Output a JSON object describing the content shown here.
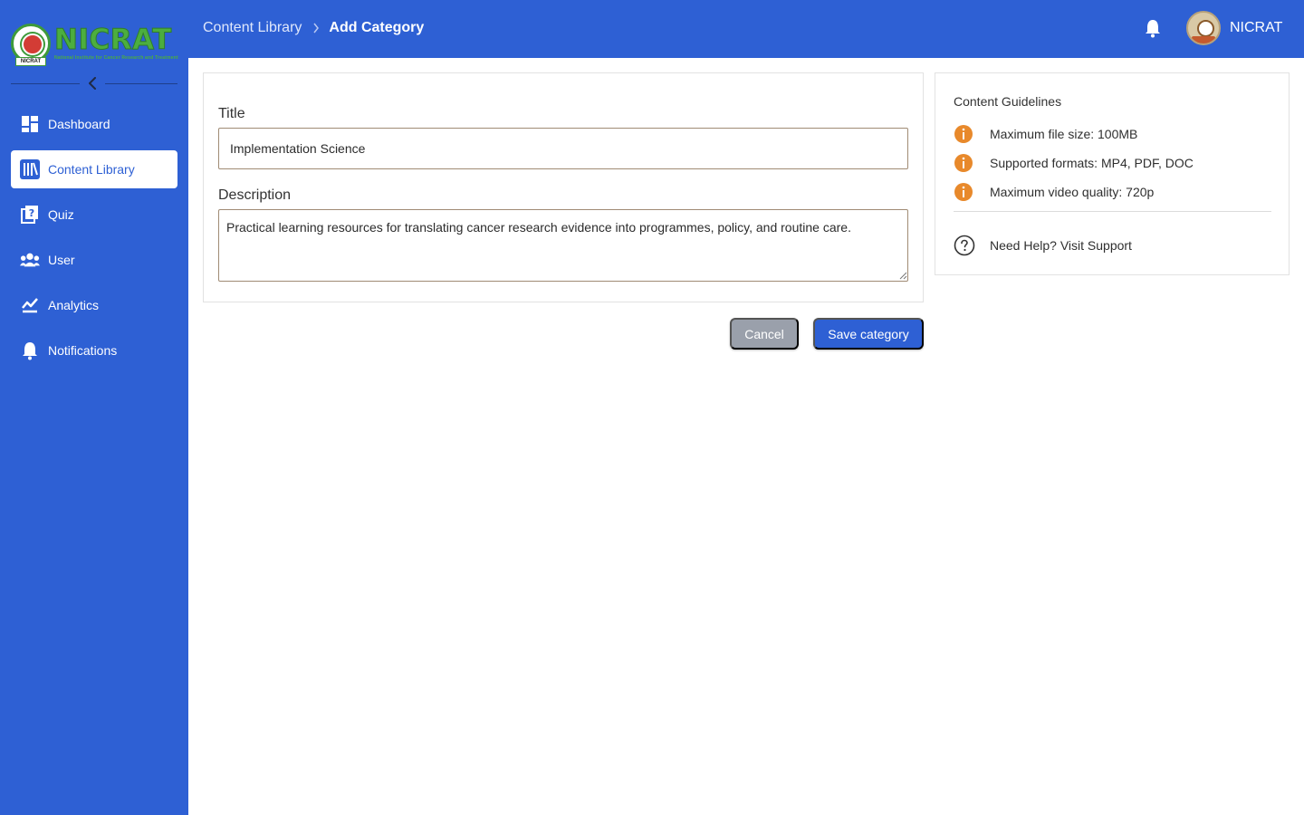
{
  "brand": {
    "name": "NICRAT",
    "tagline": "National Institute for Cancer Research and Treatment",
    "seal_text": "NICRAT",
    "colors": {
      "primary": "#2e60d4",
      "logo_green": "#4cae3f",
      "warning_orange": "#e8892b",
      "cancel_gray": "#9aa0ab"
    }
  },
  "sidebar": {
    "collapse_icon": "chevron-left-icon",
    "items": [
      {
        "label": "Dashboard",
        "icon": "dashboard-icon",
        "active": false
      },
      {
        "label": "Content Library",
        "icon": "library-icon",
        "active": true
      },
      {
        "label": "Quiz",
        "icon": "quiz-icon",
        "active": false
      },
      {
        "label": "User",
        "icon": "users-icon",
        "active": false
      },
      {
        "label": "Analytics",
        "icon": "analytics-icon",
        "active": false
      },
      {
        "label": "Notifications",
        "icon": "bell-icon",
        "active": false
      }
    ]
  },
  "header": {
    "breadcrumb": {
      "parent": "Content Library",
      "current": "Add Category"
    },
    "notification_icon": "bell-icon",
    "user": {
      "name": "NICRAT",
      "avatar_icon": "avatar-icon"
    }
  },
  "form": {
    "title_label": "Title",
    "title_value": "Implementation Science",
    "description_label": "Description",
    "description_value": "Practical learning resources for translating cancer research evidence into programmes, policy, and routine care.",
    "cancel_label": "Cancel",
    "save_label": "Save category"
  },
  "guidelines": {
    "title": "Content Guidelines",
    "items": [
      {
        "text": "Maximum file size: 100MB",
        "icon": "info-icon"
      },
      {
        "text": "Supported formats: MP4, PDF, DOC",
        "icon": "info-icon"
      },
      {
        "text": "Maximum video quality: 720p",
        "icon": "info-icon"
      }
    ],
    "help_text": "Need Help? Visit Support",
    "help_icon": "help-circle-icon"
  }
}
